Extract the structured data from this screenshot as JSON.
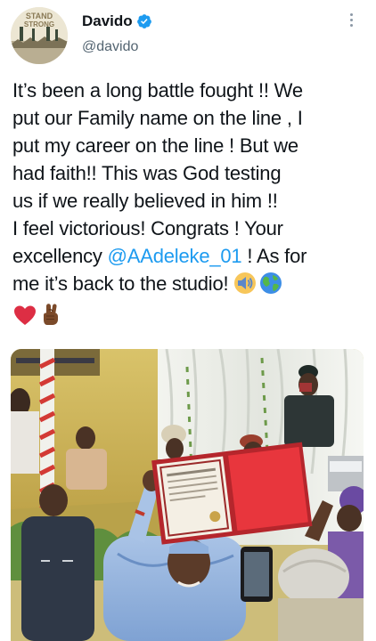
{
  "tweet": {
    "author": {
      "display_name": "Davido",
      "handle": "@davido",
      "avatar_text_line1": "STAND",
      "avatar_text_line2": "STRONG",
      "verified": true
    },
    "text_lines": [
      {
        "before": "It’s been a long battle fought !! We",
        "mention": "",
        "after": ""
      },
      {
        "before": "put our Family name on the line , I",
        "mention": "",
        "after": ""
      },
      {
        "before": "put my career on the line ! But we",
        "mention": "",
        "after": ""
      },
      {
        "before": "had faith!! This was God testing",
        "mention": "",
        "after": ""
      },
      {
        "before": "us if we really believed in him !!",
        "mention": "",
        "after": ""
      },
      {
        "before": "I feel victorious! Congrats ! Your",
        "mention": "",
        "after": ""
      },
      {
        "before": "excellency ",
        "mention": "@AAdeleke_01",
        "after": " ! As for"
      },
      {
        "before": "me it’s back to the studio! ",
        "mention": "",
        "after": ""
      }
    ],
    "emojis": [
      "speaker-icon",
      "globe-icon",
      "red-heart-icon",
      "crossed-fingers-icon"
    ],
    "colors": {
      "link": "#1d9bf0",
      "text": "#0f1419",
      "secondary": "#536471",
      "verified": "#1d9bf0"
    },
    "media": {
      "description_icon": "photo"
    }
  }
}
